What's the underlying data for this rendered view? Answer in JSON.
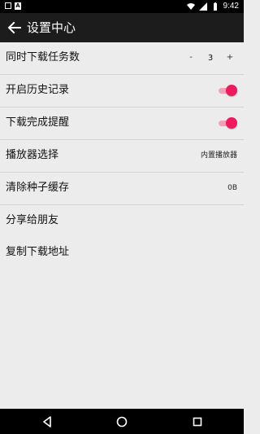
{
  "status_bar": {
    "time": "9:42",
    "left_icons": [
      "notification-square-icon",
      "a-badge-icon"
    ],
    "right_icons": [
      "wifi-icon",
      "signal-icon",
      "battery-icon"
    ]
  },
  "app_bar": {
    "title": "设置中心",
    "back_icon": "arrow-left-icon"
  },
  "settings": {
    "concurrent_downloads": {
      "label": "同时下载任务数",
      "minus": "-",
      "value": "3",
      "plus": "+"
    },
    "history": {
      "label": "开启历史记录",
      "enabled": true
    },
    "download_notify": {
      "label": "下载完成提醒",
      "enabled": true
    },
    "player": {
      "label": "播放器选择",
      "value": "内置播放器"
    },
    "clear_cache": {
      "label": "清除种子缓存",
      "value": "0B"
    },
    "share": {
      "label": "分享给朋友"
    },
    "copy_address": {
      "label": "复制下载地址"
    }
  },
  "colors": {
    "accent": "#ee1c5e",
    "accent_track": "#f1a0b8",
    "app_bar": "#1c1c1c",
    "background": "#ececec"
  },
  "nav_bar": {
    "icons": [
      "back-triangle-icon",
      "home-circle-icon",
      "recents-square-icon"
    ]
  }
}
